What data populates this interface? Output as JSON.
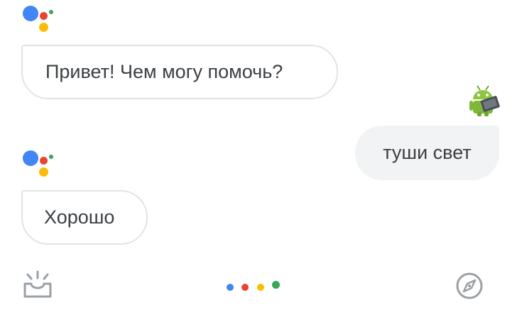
{
  "conversation": {
    "messages": [
      {
        "role": "assistant",
        "text": "Привет! Чем могу помочь?"
      },
      {
        "role": "user",
        "text": "туши свет"
      },
      {
        "role": "assistant",
        "text": "Хорошо"
      }
    ]
  },
  "icons": {
    "assistant_logo": "google-assistant-logo",
    "user_avatar": "android-robot-avatar",
    "updates": "inbox-updates-icon",
    "explore": "compass-icon",
    "listening": "google-dots-indicator"
  },
  "colors": {
    "blue": "#4285f4",
    "red": "#ea4335",
    "yellow": "#fbbc05",
    "green": "#34a853",
    "text": "#3c4043",
    "user_bubble": "#f1f3f4",
    "assistant_border": "#e3e3e3",
    "bar_icon": "#9aa0a6"
  }
}
